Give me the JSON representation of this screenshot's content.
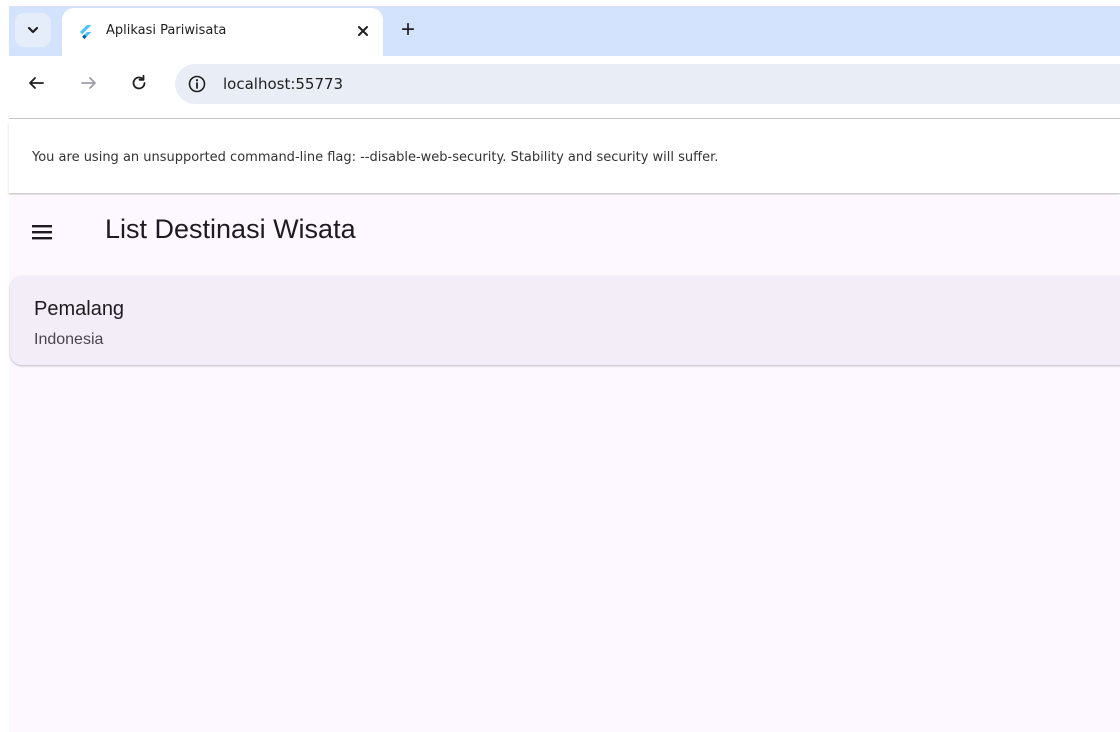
{
  "browser": {
    "tab": {
      "title": "Aplikasi Pariwisata",
      "close_icon": "close-icon",
      "favicon": "flutter-logo-icon"
    },
    "new_tab_symbol": "+",
    "address": "localhost:55773",
    "infobar_message": "You are using an unsupported command-line flag: --disable-web-security. Stability and security will suffer."
  },
  "app": {
    "title": "List Destinasi Wisata",
    "menu_icon": "menu-icon",
    "destinations": [
      {
        "name": "Pemalang",
        "country": "Indonesia"
      }
    ]
  },
  "colors": {
    "chrome_background": "#d3e3fd",
    "app_background": "#fdf7ff",
    "card_background": "#f3edf7"
  }
}
